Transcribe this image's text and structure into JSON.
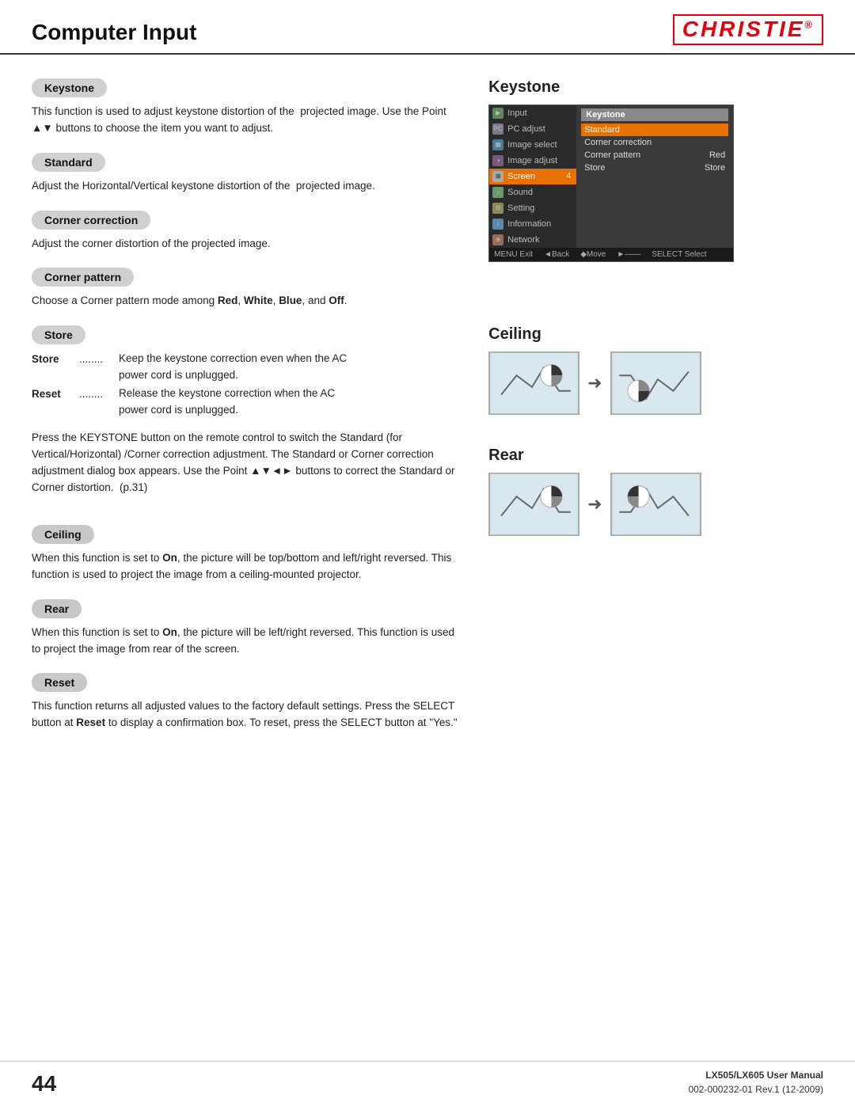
{
  "header": {
    "title": "Computer Input",
    "logo": "CHRISTIE",
    "logo_reg": "®"
  },
  "keystone_section": {
    "pill": "Keystone",
    "description": "This function is used to adjust keystone distortion of the  projected image. Use the Point ▲▼ buttons to choose the item you want to adjust.",
    "standard_pill": "Standard",
    "standard_desc": "Adjust the Horizontal/Vertical keystone distortion of the  projected image.",
    "corner_pill": "Corner correction",
    "corner_desc": "Adjust the corner distortion of the projected image.",
    "corner_pattern_pill": "Corner pattern",
    "corner_pattern_desc": "Choose a Corner pattern mode among",
    "corner_pattern_desc2": "Red",
    "corner_pattern_desc3": ", ",
    "corner_pattern_desc4": "White",
    "corner_pattern_desc5": ", ",
    "corner_pattern_desc6": "Blue",
    "corner_pattern_desc7": ", and ",
    "corner_pattern_desc8": "Off",
    "corner_pattern_desc9": ".",
    "store_pill": "Store",
    "store_term1": "Store",
    "store_dots1": "........",
    "store_text1": "Keep the keystone correction even when the AC power cord is unplugged.",
    "store_term2": "Reset",
    "store_dots2": "........",
    "store_text2": "Release the keystone correction when the AC power cord is unplugged.",
    "keystone_note": "Press the KEYSTONE button on the remote control to switch the Standard (for Vertical/Horizontal) /Corner correction adjustment. The Standard or Corner correction adjustment dialog box appears. Use the Point ▲▼◄► buttons to correct the Standard or Corner distortion.  (p.31)"
  },
  "menu_screenshot": {
    "title": "Keystone",
    "left_items": [
      {
        "label": "Input",
        "icon": "I"
      },
      {
        "label": "PC adjust",
        "icon": "P"
      },
      {
        "label": "Image select",
        "icon": "S"
      },
      {
        "label": "Image adjust",
        "icon": "A"
      },
      {
        "label": "Screen",
        "icon": "Sc",
        "highlighted": true,
        "badge": "4"
      },
      {
        "label": "Sound",
        "icon": "So"
      },
      {
        "label": "Setting",
        "icon": "Se"
      },
      {
        "label": "Information",
        "icon": "In"
      },
      {
        "label": "Network",
        "icon": "N"
      }
    ],
    "right_title": "Keystone",
    "right_items": [
      {
        "label": "Standard",
        "selected": true
      },
      {
        "label": "Corner correction",
        "value": ""
      },
      {
        "label": "Corner pattern",
        "value": "Red"
      },
      {
        "label": "Store",
        "value": "Store"
      }
    ],
    "footer_items": [
      "MENU Exit",
      "◄Back",
      "◆Move",
      "►——",
      "SELECT Select"
    ]
  },
  "heading_keystone": "Keystone",
  "heading_ceiling": "Ceiling",
  "ceiling_section": {
    "pill": "Ceiling",
    "description": "When this function is set to",
    "bold1": "On",
    "desc2": ", the picture will be top/bottom and left/right reversed. This function is used to project the image from a ceiling-mounted projector."
  },
  "heading_rear": "Rear",
  "rear_section": {
    "pill": "Rear",
    "description": "When this function is set to",
    "bold1": "On",
    "desc2": ", the picture will be left/right reversed. This function is used to project the image from rear of the screen."
  },
  "reset_section": {
    "pill": "Reset",
    "description": "This function returns all adjusted values to the factory default settings. Press the SELECT button at",
    "bold1": "Reset",
    "desc2": "to display a confirmation box. To reset, press the SELECT button at \"Yes.\""
  },
  "footer": {
    "page_number": "44",
    "manual": "LX505/LX605 User Manual",
    "doc_number": "002-000232-01 Rev.1 (12-2009)"
  }
}
